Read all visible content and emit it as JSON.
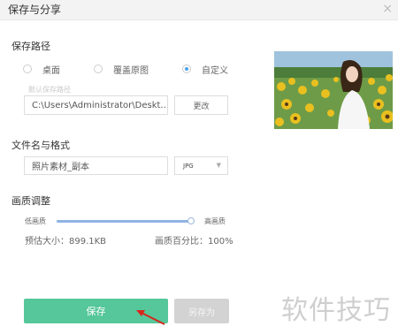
{
  "dialog": {
    "title": "保存与分享",
    "close_glyph": "×"
  },
  "save_path": {
    "label": "保存路径",
    "options": [
      {
        "label": "桌面",
        "selected": false
      },
      {
        "label": "覆盖原图",
        "selected": false
      },
      {
        "label": "自定义",
        "selected": true
      }
    ],
    "hint": "默认保存路径",
    "path_value": "C:\\Users\\Administrator\\Deskt...",
    "change_label": "更改"
  },
  "file": {
    "label": "文件名与格式",
    "name_value": "照片素材_副本",
    "format_value": "JPG"
  },
  "quality": {
    "label": "画质调整",
    "low_label": "低画质",
    "high_label": "高画质",
    "level": 1.0,
    "estimated_size": "预估大小：899.1KB",
    "percent": "画质百分比：100%"
  },
  "actions": {
    "save_label": "保存",
    "save_as_label": "另存为"
  },
  "watermark": "软件技巧",
  "colors": {
    "primary": "#55c79a",
    "radio_accent": "#4aa3e8",
    "arrow": "#d9251c"
  }
}
